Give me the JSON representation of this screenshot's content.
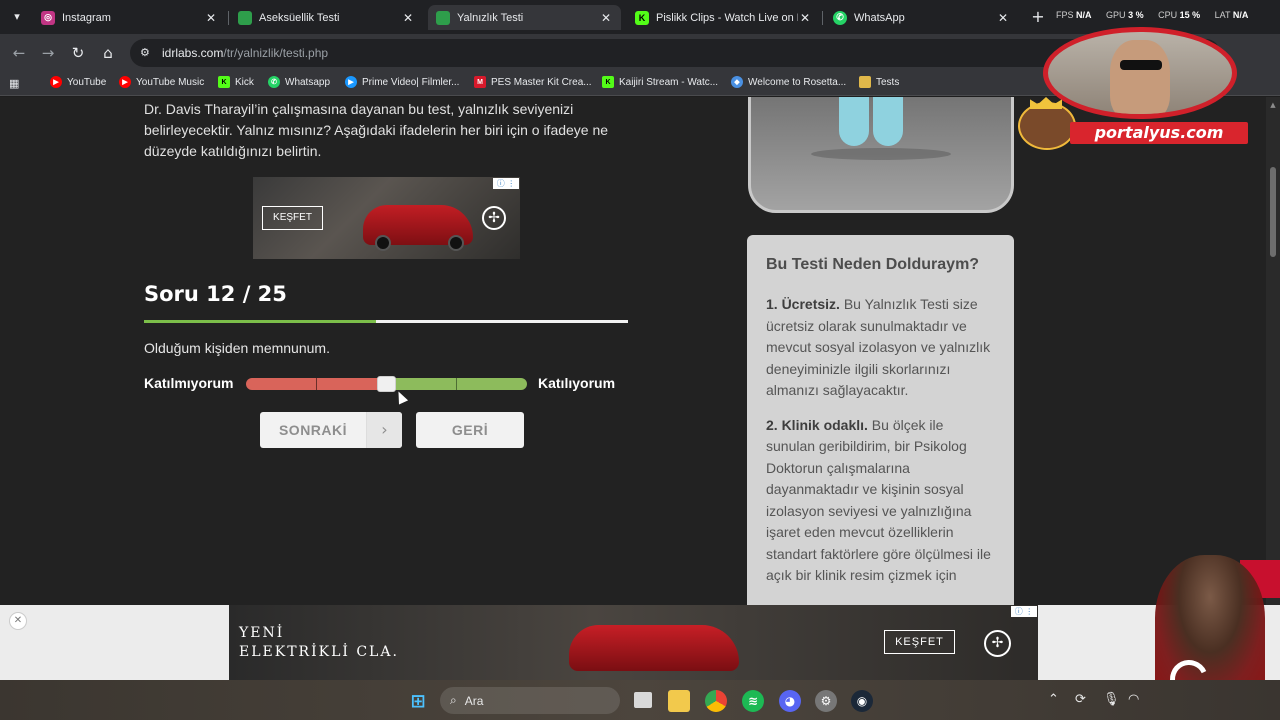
{
  "browser": {
    "tabs": [
      {
        "title": "Instagram",
        "icon": "instagram-icon",
        "color": "#c13584"
      },
      {
        "title": "Aseksüellik Testi",
        "icon": "idrlabs-icon",
        "color": "#2e9e4b"
      },
      {
        "title": "Yalnızlık Testi",
        "icon": "idrlabs-icon",
        "color": "#2e9e4b"
      },
      {
        "title": "Pislikk Clips - Watch Live on Kic",
        "icon": "kick-icon",
        "color": "#53fc18"
      },
      {
        "title": "WhatsApp",
        "icon": "whatsapp-icon",
        "color": "#25d366"
      }
    ],
    "active_tab": 2,
    "url_host": "idrlabs.com",
    "url_path": "/tr/yalnizlik/testi.php",
    "hud": [
      {
        "label": "FPS",
        "value": "N/A"
      },
      {
        "label": "GPU",
        "value": "3 %"
      },
      {
        "label": "CPU",
        "value": "15 %"
      },
      {
        "label": "LAT",
        "value": "N/A"
      }
    ],
    "bookmarks": [
      {
        "label": "YouTube",
        "icon": "youtube-icon",
        "color": "#ff0000"
      },
      {
        "label": "YouTube Music",
        "icon": "youtube-music-icon",
        "color": "#ff0000"
      },
      {
        "label": "Kick",
        "icon": "kick-icon",
        "color": "#53fc18"
      },
      {
        "label": "Whatsapp",
        "icon": "whatsapp-icon",
        "color": "#25d366"
      },
      {
        "label": "Prime Video| Filmler...",
        "icon": "prime-video-icon",
        "color": "#1a98ff"
      },
      {
        "label": "PES Master Kit Crea...",
        "icon": "pes-master-icon",
        "color": "#d8192b"
      },
      {
        "label": "Kaijiri Stream - Watc...",
        "icon": "kick-icon",
        "color": "#53fc18"
      },
      {
        "label": "Welcome to Rosetta...",
        "icon": "rosetta-icon",
        "color": "#4a90e2"
      },
      {
        "label": "Tests",
        "icon": "folder-icon",
        "color": "#e0b84a"
      }
    ]
  },
  "page": {
    "intro": "Dr. Davis Tharayil’in çalışmasına dayanan bu test, yalnızlık seviyenizi belirleyecektir. Yalnız mısınız? Aşağıdaki ifadelerin her biri için o ifadeye ne düzeyde katıldığınızı belirtin.",
    "ad_small_button": "KEŞFET",
    "question_title": "Soru 12 / 25",
    "progress_fraction": 0.48,
    "question_text": "Olduğum kişiden memnunum.",
    "scale_left": "Katılmıyorum",
    "scale_right": "Katılıyorum",
    "slider_position": 0.5,
    "next_button": "SONRAKİ",
    "back_button": "GERİ",
    "why_title": "Bu Testi Neden Dolduraym?",
    "why_items": [
      {
        "bold": "1. Ücretsiz.",
        "text": " Bu Yalnızlık Testi size ücretsiz olarak sunulmaktadır ve mevcut sosyal izolasyon ve yalnızlık deneyiminizle ilgili skorlarınızı almanızı sağlayacaktır."
      },
      {
        "bold": "2. Klinik odaklı.",
        "text": " Bu ölçek ile sunulan geribildirim, bir Psikolog Doktorun çalışmalarına dayanmaktadır ve kişinin sosyal izolasyon seviyesi ve yalnızlığına işaret eden mevcut özelliklerin standart faktörlere göre ölçülmesi ile açık bir klinik resim çizmek için"
      }
    ]
  },
  "ad_banner": {
    "line1": "YENİ",
    "line2": "ELEKTRİKLİ CLA.",
    "button": "KEŞFET"
  },
  "overlay": {
    "watermark": "portalyus.com"
  },
  "taskbar": {
    "search_placeholder": "Ara"
  }
}
